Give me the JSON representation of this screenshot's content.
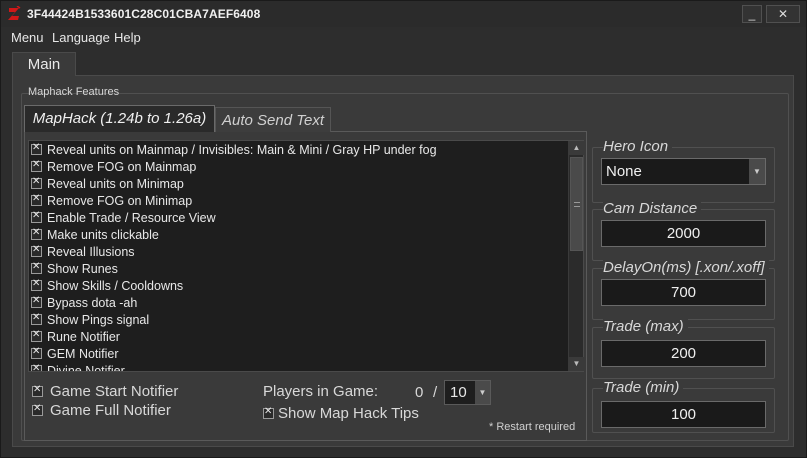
{
  "window": {
    "title": "3F44424B1533601C28C01CBA7AEF6408",
    "minimize_label": "_",
    "close_label": "✕"
  },
  "menubar": {
    "items": [
      "Menu",
      "Language",
      "Help"
    ]
  },
  "main_tab": {
    "label": "Main"
  },
  "group": {
    "label": "Maphack Features"
  },
  "inner_tabs": [
    {
      "label": "MapHack (1.24b to 1.26a)",
      "active": true
    },
    {
      "label": "Auto Send Text",
      "active": false
    }
  ],
  "features": [
    {
      "label": "Reveal units on Mainmap / Invisibles: Main & Mini / Gray HP under fog",
      "checked": true
    },
    {
      "label": "Remove FOG on Mainmap",
      "checked": true
    },
    {
      "label": "Reveal units on Minimap",
      "checked": true
    },
    {
      "label": "Remove FOG on Minimap",
      "checked": true
    },
    {
      "label": "Enable Trade / Resource View",
      "checked": true
    },
    {
      "label": "Make units clickable",
      "checked": true
    },
    {
      "label": "Reveal Illusions",
      "checked": true
    },
    {
      "label": "Show Runes",
      "checked": true
    },
    {
      "label": "Show Skills / Cooldowns",
      "checked": true
    },
    {
      "label": "Bypass dota -ah",
      "checked": true
    },
    {
      "label": "Show Pings signal",
      "checked": true
    },
    {
      "label": "Rune Notifier",
      "checked": true
    },
    {
      "label": "GEM Notifier",
      "checked": true
    },
    {
      "label": "Divine Notifier",
      "checked": true
    }
  ],
  "options": {
    "game_start_notifier": "Game Start Notifier",
    "game_full_notifier": "Game Full Notifier",
    "show_map_hack_tips": "Show Map Hack Tips",
    "players_label": "Players in Game:",
    "players_current": "0",
    "players_separator": "/",
    "players_max": "10",
    "restart_note": "* Restart required"
  },
  "right_panel": {
    "hero_icon": {
      "label": "Hero Icon",
      "value": "None"
    },
    "cam_distance": {
      "label": "Cam Distance",
      "value": "2000"
    },
    "delay_on": {
      "label": "DelayOn(ms) [.xon/.xoff]",
      "value": "700"
    },
    "trade_max": {
      "label": "Trade (max)",
      "value": "200"
    },
    "trade_min": {
      "label": "Trade (min)",
      "value": "100"
    }
  },
  "colors": {
    "background": "#2d2d2d",
    "panel": "#3a3a3a",
    "list_background": "#1e1e1e",
    "text": "#e0e0e0",
    "logo_red": "#d01818"
  },
  "icons": {
    "app": "red-z-logo-icon",
    "checkbox": "checkbox-x-icon",
    "dropdown": "chevron-down-icon",
    "scroll_up": "arrow-up-icon",
    "scroll_down": "arrow-down-icon"
  }
}
